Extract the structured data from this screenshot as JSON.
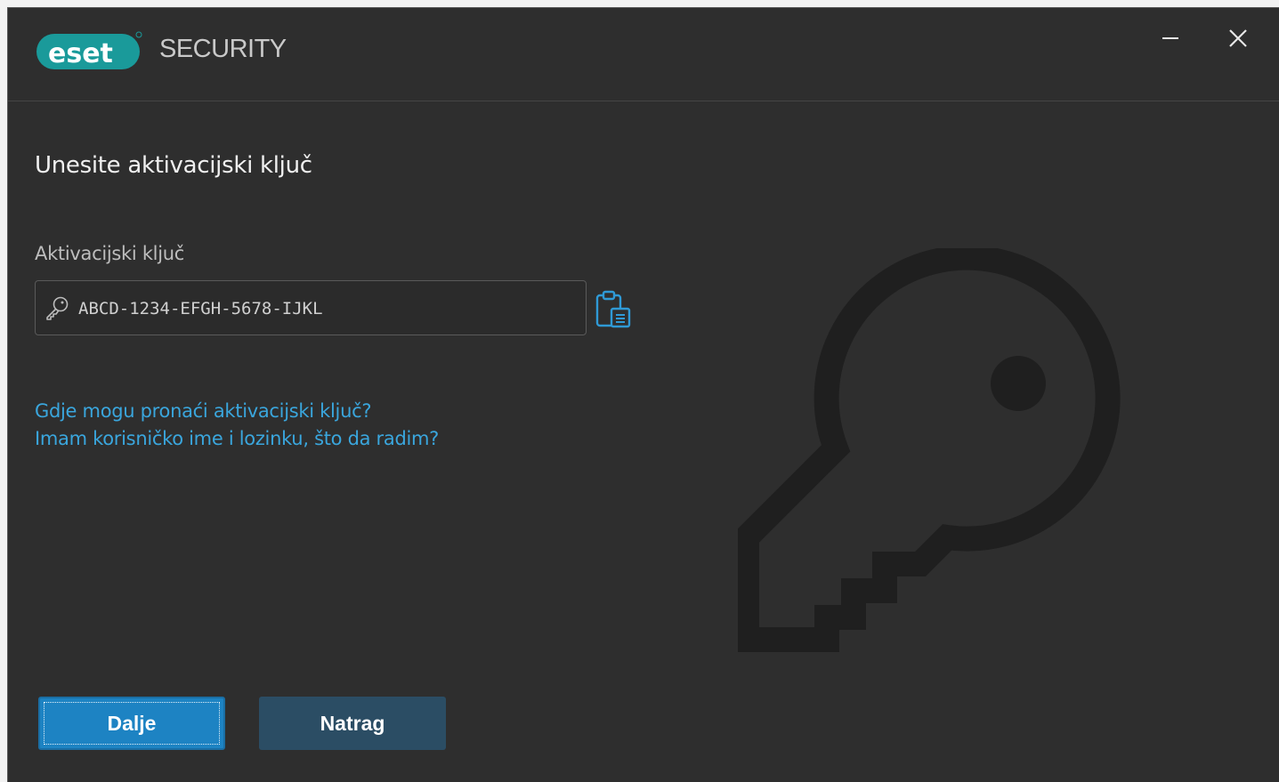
{
  "app": {
    "logo_text": "eset",
    "product_name": "SECURITY"
  },
  "window_controls": {
    "minimize_label": "—",
    "close_label": "✕"
  },
  "main": {
    "heading": "Unesite aktivacijski ključ",
    "field_label": "Aktivacijski ključ",
    "input_value": "",
    "input_placeholder": "ABCD-1234-EFGH-5678-IJKL",
    "links": [
      "Gdje mogu pronaći aktivacijski ključ?",
      "Imam korisničko ime i lozinku, što da radim?"
    ]
  },
  "buttons": {
    "next_label": "Dalje",
    "back_label": "Natrag"
  },
  "icons": {
    "logo": "eset-logo",
    "minimize": "minimize-icon",
    "close": "close-icon",
    "key": "key-icon",
    "paste": "clipboard-paste-icon",
    "background": "large-key-illustration"
  },
  "colors": {
    "window_bg": "#2e2e2e",
    "accent": "#1d83c3",
    "link": "#3aa6dd",
    "secondary_button": "#2b4d64",
    "logo_teal": "#1a9a9a"
  }
}
